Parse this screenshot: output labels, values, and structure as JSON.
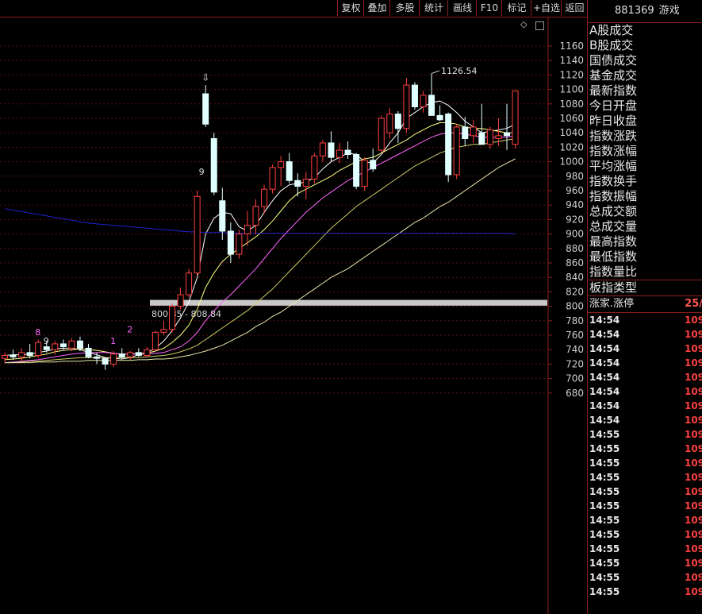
{
  "toolbar": {
    "buttons": [
      "复权",
      "叠加",
      "多股",
      "统计",
      "画线",
      "F10",
      "标记",
      "+自选",
      "返回"
    ]
  },
  "header": {
    "code": "881369",
    "name": "游戏"
  },
  "stats_labels": [
    "A股成交",
    "B股成交",
    "国债成交",
    "基金成交",
    "最新指数",
    "今日开盘",
    "昨日收盘",
    "指数涨跌",
    "指数涨幅",
    "平均涨幅",
    "指数换手",
    "指数振幅",
    "总成交额",
    "总成交量",
    "最高指数",
    "最低指数",
    "指数量比",
    "板指类型"
  ],
  "limit_row": {
    "label": "涨家.涨停",
    "count": "25/"
  },
  "trades": [
    {
      "time": "14:54",
      "value": "109"
    },
    {
      "time": "14:54",
      "value": "109"
    },
    {
      "time": "14:54",
      "value": "109"
    },
    {
      "time": "14:54",
      "value": "109"
    },
    {
      "time": "14:54",
      "value": "109"
    },
    {
      "time": "14:54",
      "value": "109"
    },
    {
      "time": "14:54",
      "value": "109"
    },
    {
      "time": "14:54",
      "value": "109"
    },
    {
      "time": "14:55",
      "value": "109"
    },
    {
      "time": "14:55",
      "value": "109"
    },
    {
      "time": "14:55",
      "value": "109"
    },
    {
      "time": "14:55",
      "value": "109"
    },
    {
      "time": "14:55",
      "value": "109"
    },
    {
      "time": "14:55",
      "value": "109"
    },
    {
      "time": "14:55",
      "value": "109"
    },
    {
      "time": "14:55",
      "value": "109"
    },
    {
      "time": "14:55",
      "value": "109"
    },
    {
      "time": "14:55",
      "value": "109"
    },
    {
      "time": "14:55",
      "value": "109"
    },
    {
      "time": "14:55",
      "value": "109"
    }
  ],
  "colors": {
    "up": "#ff4040",
    "down_fill": "#e0ffff",
    "axis": "#8b1e1e",
    "grid": "#5a1010",
    "band": "#c8c8c8"
  },
  "chart_data": {
    "type": "candlestick",
    "ylim": [
      680,
      1180
    ],
    "yticks": [
      680,
      700,
      720,
      740,
      760,
      780,
      800,
      820,
      840,
      860,
      880,
      900,
      920,
      940,
      960,
      980,
      1000,
      1020,
      1040,
      1060,
      1080,
      1100,
      1120,
      1140,
      1160
    ],
    "max_label": "1126.54",
    "band_label": "800.85 - 808.84",
    "band": [
      800.85,
      808.84
    ],
    "marks": [
      "8",
      "9",
      "1",
      "2",
      "9"
    ],
    "candles": [
      {
        "o": 728,
        "h": 736,
        "l": 722,
        "c": 732
      },
      {
        "o": 732,
        "h": 740,
        "l": 726,
        "c": 730
      },
      {
        "o": 730,
        "h": 742,
        "l": 724,
        "c": 736
      },
      {
        "o": 736,
        "h": 748,
        "l": 728,
        "c": 732
      },
      {
        "o": 732,
        "h": 754,
        "l": 728,
        "c": 750
      },
      {
        "o": 744,
        "h": 752,
        "l": 736,
        "c": 740
      },
      {
        "o": 740,
        "h": 752,
        "l": 733,
        "c": 748
      },
      {
        "o": 748,
        "h": 754,
        "l": 740,
        "c": 744
      },
      {
        "o": 742,
        "h": 756,
        "l": 738,
        "c": 752
      },
      {
        "o": 752,
        "h": 758,
        "l": 738,
        "c": 742
      },
      {
        "o": 742,
        "h": 748,
        "l": 728,
        "c": 730
      },
      {
        "o": 730,
        "h": 736,
        "l": 720,
        "c": 728
      },
      {
        "o": 728,
        "h": 730,
        "l": 712,
        "c": 720
      },
      {
        "o": 720,
        "h": 738,
        "l": 716,
        "c": 734
      },
      {
        "o": 734,
        "h": 742,
        "l": 728,
        "c": 730
      },
      {
        "o": 730,
        "h": 738,
        "l": 726,
        "c": 736
      },
      {
        "o": 736,
        "h": 742,
        "l": 730,
        "c": 732
      },
      {
        "o": 732,
        "h": 744,
        "l": 730,
        "c": 740
      },
      {
        "o": 740,
        "h": 766,
        "l": 738,
        "c": 764
      },
      {
        "o": 764,
        "h": 780,
        "l": 760,
        "c": 768
      },
      {
        "o": 768,
        "h": 804,
        "l": 764,
        "c": 800
      },
      {
        "o": 800,
        "h": 826,
        "l": 796,
        "c": 816
      },
      {
        "o": 816,
        "h": 852,
        "l": 812,
        "c": 846
      },
      {
        "o": 846,
        "h": 960,
        "l": 842,
        "c": 952
      },
      {
        "o": 1094,
        "h": 1106,
        "l": 1048,
        "c": 1052
      },
      {
        "o": 1032,
        "h": 1040,
        "l": 954,
        "c": 958
      },
      {
        "o": 946,
        "h": 964,
        "l": 892,
        "c": 904
      },
      {
        "o": 904,
        "h": 916,
        "l": 860,
        "c": 872
      },
      {
        "o": 872,
        "h": 906,
        "l": 866,
        "c": 900
      },
      {
        "o": 900,
        "h": 932,
        "l": 884,
        "c": 912
      },
      {
        "o": 912,
        "h": 948,
        "l": 900,
        "c": 938
      },
      {
        "o": 938,
        "h": 968,
        "l": 928,
        "c": 962
      },
      {
        "o": 962,
        "h": 996,
        "l": 956,
        "c": 992
      },
      {
        "o": 992,
        "h": 1008,
        "l": 966,
        "c": 1000
      },
      {
        "o": 1000,
        "h": 1012,
        "l": 970,
        "c": 974
      },
      {
        "o": 974,
        "h": 984,
        "l": 952,
        "c": 966
      },
      {
        "o": 966,
        "h": 986,
        "l": 948,
        "c": 976
      },
      {
        "o": 976,
        "h": 1012,
        "l": 970,
        "c": 1008
      },
      {
        "o": 1008,
        "h": 1030,
        "l": 1000,
        "c": 1026
      },
      {
        "o": 1026,
        "h": 1042,
        "l": 1000,
        "c": 1006
      },
      {
        "o": 1006,
        "h": 1026,
        "l": 998,
        "c": 1016
      },
      {
        "o": 1016,
        "h": 1028,
        "l": 1004,
        "c": 1010
      },
      {
        "o": 1010,
        "h": 1012,
        "l": 962,
        "c": 966
      },
      {
        "o": 966,
        "h": 1006,
        "l": 960,
        "c": 1002
      },
      {
        "o": 1002,
        "h": 1018,
        "l": 986,
        "c": 990
      },
      {
        "o": 1016,
        "h": 1064,
        "l": 1012,
        "c": 1060
      },
      {
        "o": 1040,
        "h": 1074,
        "l": 1032,
        "c": 1066
      },
      {
        "o": 1066,
        "h": 1070,
        "l": 1026,
        "c": 1046
      },
      {
        "o": 1046,
        "h": 1116,
        "l": 1040,
        "c": 1106
      },
      {
        "o": 1106,
        "h": 1110,
        "l": 1072,
        "c": 1076
      },
      {
        "o": 1076,
        "h": 1098,
        "l": 1068,
        "c": 1092
      },
      {
        "o": 1092,
        "h": 1122,
        "l": 1080,
        "c": 1064
      },
      {
        "o": 1064,
        "h": 1078,
        "l": 1056,
        "c": 1058
      },
      {
        "o": 1066,
        "h": 1068,
        "l": 972,
        "c": 982
      },
      {
        "o": 982,
        "h": 1052,
        "l": 976,
        "c": 1048
      },
      {
        "o": 1048,
        "h": 1062,
        "l": 1022,
        "c": 1032
      },
      {
        "o": 1036,
        "h": 1058,
        "l": 1026,
        "c": 1048
      },
      {
        "o": 1040,
        "h": 1080,
        "l": 1028,
        "c": 1024
      },
      {
        "o": 1024,
        "h": 1048,
        "l": 1018,
        "c": 1044
      },
      {
        "o": 1032,
        "h": 1060,
        "l": 1022,
        "c": 1036
      },
      {
        "o": 1040,
        "h": 1080,
        "l": 1016,
        "c": 1036
      },
      {
        "o": 1024,
        "h": 1056,
        "l": 1018,
        "c": 1098
      }
    ],
    "ma_lines": [
      {
        "color": "#ffffff",
        "values": [
          732,
          733,
          733,
          734,
          736,
          738,
          741,
          742,
          742,
          740,
          736,
          733,
          729,
          728,
          727,
          729,
          733,
          735,
          742,
          752,
          766,
          784,
          806,
          840,
          900,
          922,
          930,
          928,
          910,
          904,
          912,
          930,
          946,
          960,
          968,
          970,
          972,
          978,
          990,
          1000,
          1006,
          1012,
          1010,
          1000,
          998,
          1010,
          1026,
          1040,
          1060,
          1068,
          1076,
          1082,
          1084,
          1078,
          1068,
          1056,
          1048,
          1040,
          1042,
          1044,
          1046,
          1052
        ]
      },
      {
        "color": "#ffff80",
        "values": [
          726,
          727,
          728,
          730,
          732,
          734,
          737,
          739,
          740,
          741,
          740,
          739,
          737,
          735,
          734,
          734,
          735,
          735,
          738,
          742,
          750,
          760,
          774,
          796,
          826,
          846,
          862,
          872,
          880,
          888,
          896,
          906,
          918,
          932,
          946,
          956,
          962,
          968,
          974,
          980,
          988,
          994,
          1000,
          1004,
          1006,
          1012,
          1018,
          1024,
          1030,
          1038,
          1044,
          1050,
          1054,
          1054,
          1052,
          1048,
          1046,
          1046,
          1044,
          1042,
          1040,
          1040
        ]
      },
      {
        "color": "#ff66ff",
        "values": [
          722,
          723,
          724,
          725,
          726,
          728,
          730,
          732,
          734,
          735,
          736,
          736,
          736,
          735,
          734,
          734,
          734,
          734,
          735,
          736,
          740,
          744,
          752,
          764,
          780,
          794,
          806,
          816,
          828,
          840,
          852,
          866,
          880,
          894,
          906,
          918,
          930,
          940,
          950,
          958,
          966,
          974,
          980,
          986,
          992,
          998,
          1004,
          1010,
          1016,
          1022,
          1028,
          1034,
          1038,
          1040,
          1040,
          1038,
          1036,
          1034,
          1034,
          1034,
          1034,
          1036
        ]
      },
      {
        "color": "#cccc66",
        "values": [
          722,
          722,
          723,
          724,
          724,
          725,
          726,
          727,
          728,
          729,
          729,
          729,
          729,
          729,
          729,
          729,
          729,
          730,
          731,
          732,
          734,
          737,
          741,
          746,
          754,
          762,
          770,
          778,
          786,
          794,
          804,
          814,
          824,
          836,
          848,
          860,
          872,
          884,
          896,
          908,
          918,
          928,
          938,
          946,
          954,
          962,
          970,
          978,
          986,
          994,
          1000,
          1006,
          1012,
          1016,
          1020,
          1022,
          1024,
          1024,
          1026,
          1028,
          1030,
          1032
        ]
      },
      {
        "color": "#e8e8b0",
        "values": [
          722,
          722,
          722,
          722,
          723,
          723,
          723,
          724,
          724,
          724,
          725,
          725,
          725,
          725,
          725,
          725,
          726,
          726,
          727,
          727,
          728,
          730,
          732,
          735,
          738,
          742,
          746,
          752,
          758,
          764,
          772,
          778,
          786,
          792,
          800,
          808,
          816,
          824,
          832,
          840,
          846,
          852,
          860,
          868,
          876,
          884,
          892,
          900,
          908,
          916,
          922,
          930,
          938,
          944,
          952,
          960,
          968,
          976,
          984,
          992,
          998,
          1004
        ]
      },
      {
        "color": "#2020cc",
        "values": [
          935,
          933,
          931,
          929,
          927,
          925,
          923,
          921,
          919,
          917,
          915,
          914,
          913,
          912,
          911,
          910,
          909,
          908,
          907,
          906,
          905,
          904,
          903,
          903,
          902,
          902,
          902,
          901,
          901,
          901,
          901,
          901,
          901,
          901,
          901,
          901,
          901,
          901,
          901,
          901,
          901,
          901,
          901,
          901,
          901,
          901,
          901,
          901,
          901,
          901,
          901,
          901,
          901,
          901,
          901,
          901,
          901,
          901,
          901,
          901,
          901,
          900
        ]
      }
    ]
  }
}
